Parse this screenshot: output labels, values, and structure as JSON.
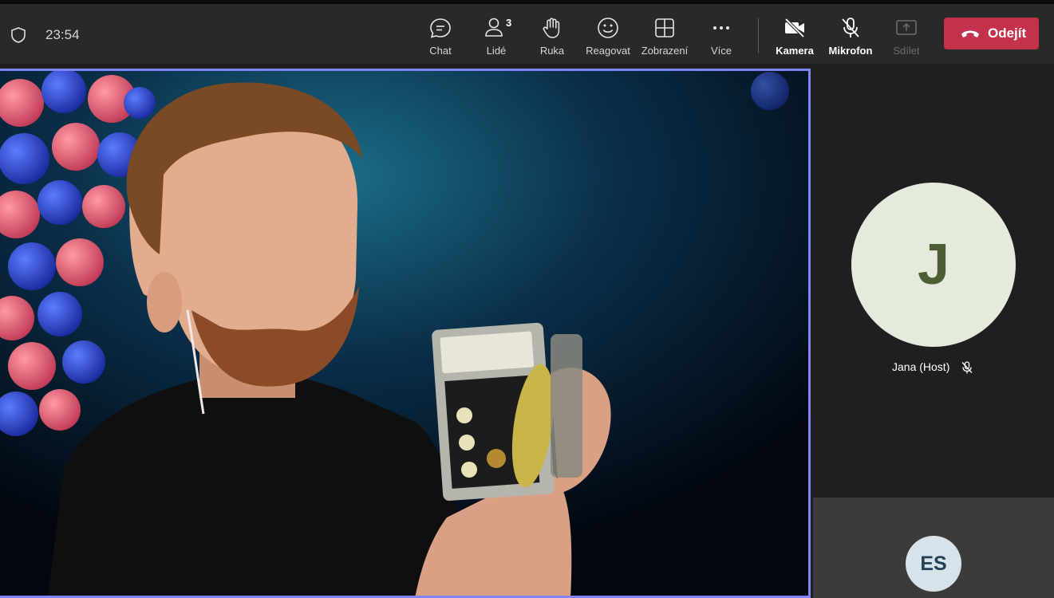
{
  "toolbar": {
    "time": "23:54",
    "buttons": {
      "chat": "Chat",
      "people": "Lidé",
      "people_count": "3",
      "hand": "Ruka",
      "react": "Reagovat",
      "view": "Zobrazení",
      "more": "Více",
      "camera": "Kamera",
      "mic": "Mikrofon",
      "share": "Sdílet"
    },
    "leave": "Odejít"
  },
  "participants": {
    "host": {
      "initial": "J",
      "name": "Jana (Host)"
    },
    "second": {
      "initials": "ES"
    }
  },
  "colors": {
    "active_speaker_border": "#7f85f5",
    "leave_button": "#c4314b",
    "host_avatar_bg": "#e5ebdc",
    "second_avatar_bg": "#d7e3ea"
  },
  "icons": [
    "shield-icon",
    "chat-icon",
    "people-icon",
    "hand-icon",
    "smile-icon",
    "view-grid-icon",
    "more-icon",
    "camera-off-icon",
    "mic-off-icon",
    "share-icon",
    "phone-hangup-icon"
  ]
}
